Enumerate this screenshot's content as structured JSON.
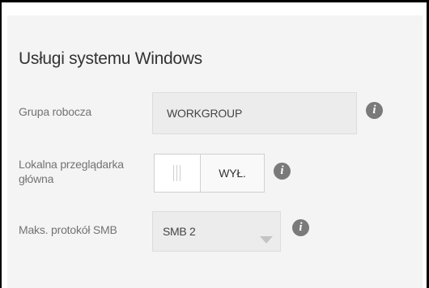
{
  "section": {
    "title": "Usługi systemu Windows"
  },
  "workgroup": {
    "label": "Grupa robocza",
    "value": "WORKGROUP",
    "info_icon": "info-icon"
  },
  "local_master_browser": {
    "label": "Lokalna przeglądarka główna",
    "toggle_state": "WYŁ.",
    "enabled": false,
    "info_icon": "info-icon"
  },
  "max_smb_protocol": {
    "label": "Maks. protokół SMB",
    "selected": "SMB 2",
    "info_icon": "info-icon"
  },
  "info_glyph": "i",
  "colors": {
    "panel_background": "#f4f4f4",
    "field_background": "#ececec",
    "info_icon": "#7a7a7a",
    "label_text": "#737373",
    "title_text": "#333333"
  }
}
